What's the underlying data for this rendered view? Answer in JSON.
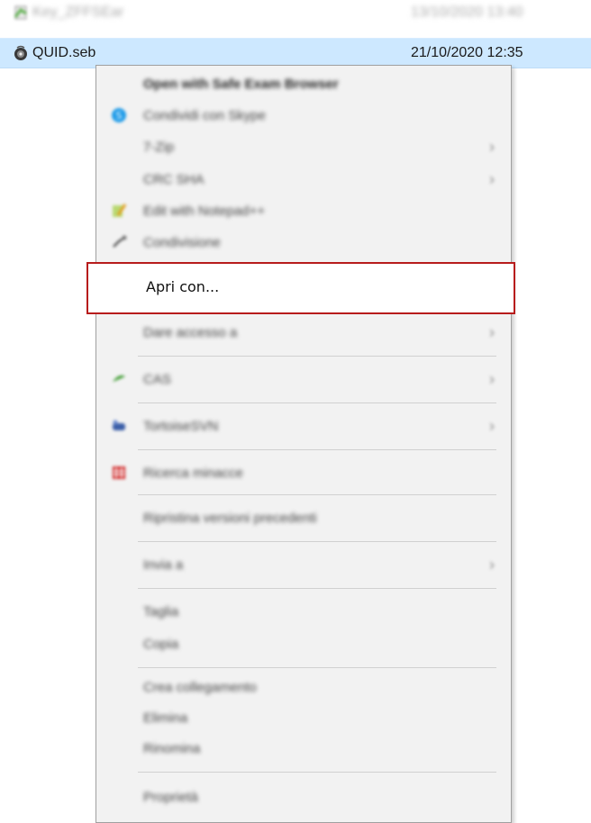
{
  "files": [
    {
      "name": "Key_ZFFSEar",
      "date": "13/10/2020 13:40",
      "icon": "document-icon"
    },
    {
      "name": "QUID.seb",
      "date": "21/10/2020 12:35",
      "icon": "seb-file-icon"
    }
  ],
  "context_menu": {
    "items": [
      {
        "label": "Open with Safe Exam Browser",
        "icon": "",
        "bold": true,
        "submenu": false
      },
      {
        "label": "Condividi con Skype",
        "icon": "skype-icon",
        "bold": false,
        "submenu": false
      },
      {
        "label": "7-Zip",
        "icon": "",
        "bold": false,
        "submenu": true
      },
      {
        "label": "CRC SHA",
        "icon": "",
        "bold": false,
        "submenu": true
      },
      {
        "label": "Edit with Notepad++",
        "icon": "notepad-icon",
        "bold": false,
        "submenu": false
      },
      {
        "label": "Condivisione",
        "icon": "share-icon",
        "bold": false,
        "submenu": false
      },
      {
        "label": "Apri con...",
        "icon": "",
        "bold": false,
        "submenu": false
      },
      {
        "label": "Dare accesso a",
        "icon": "",
        "bold": false,
        "submenu": true
      },
      {
        "label": "CAS",
        "icon": "cas-icon",
        "bold": false,
        "submenu": true
      },
      {
        "label": "TortoiseSVN",
        "icon": "tortoise-icon",
        "bold": false,
        "submenu": true
      },
      {
        "label": "Ricerca minacce",
        "icon": "shield-icon",
        "bold": false,
        "submenu": false
      },
      {
        "label": "Ripristina versioni precedenti",
        "icon": "",
        "bold": false,
        "submenu": false
      },
      {
        "label": "Invia a",
        "icon": "",
        "bold": false,
        "submenu": true
      },
      {
        "label": "Taglia",
        "icon": "",
        "bold": false,
        "submenu": false
      },
      {
        "label": "Copia",
        "icon": "",
        "bold": false,
        "submenu": false
      },
      {
        "label": "Crea collegamento",
        "icon": "",
        "bold": false,
        "submenu": false
      },
      {
        "label": "Elimina",
        "icon": "",
        "bold": false,
        "submenu": false
      },
      {
        "label": "Rinomina",
        "icon": "",
        "bold": false,
        "submenu": false
      },
      {
        "label": "Proprietà",
        "icon": "",
        "bold": false,
        "submenu": false
      }
    ],
    "highlighted_label": "Apri con..."
  },
  "colors": {
    "selection": "#cde8ff",
    "menu_background": "#f2f2f2",
    "highlight_border": "#b71c1c"
  }
}
